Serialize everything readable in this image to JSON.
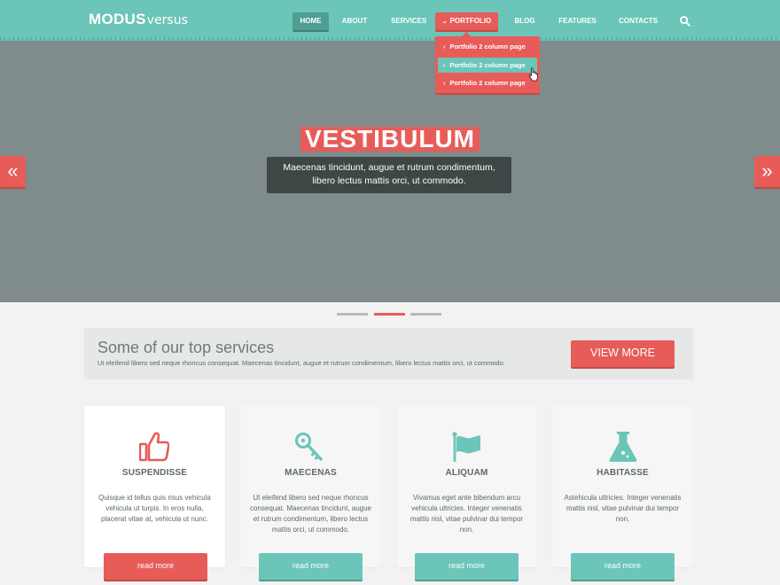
{
  "header": {
    "logo_main": "MODUS",
    "logo_sub": "versus",
    "nav": [
      {
        "label": "HOME"
      },
      {
        "label": "ABOUT"
      },
      {
        "label": "SERVICES"
      },
      {
        "label": "PORTFOLIO"
      },
      {
        "label": "BLOG"
      },
      {
        "label": "FEATURES"
      },
      {
        "label": "CONTACTS"
      }
    ],
    "search_icon": "search-icon",
    "active_nav": "HOME",
    "open_menu": "PORTFOLIO"
  },
  "dropdown": {
    "items": [
      {
        "label": "Portfolio 2 column page"
      },
      {
        "label": "Portfolio 2 column page"
      },
      {
        "label": "Portfolio 2 column page"
      }
    ],
    "hovered_index": 1
  },
  "hero": {
    "title": "VESTIBULUM",
    "caption_line1": "Maecenas tincidunt, augue et rutrum condimentum,",
    "caption_line2": "libero lectus mattis orci, ut commodo.",
    "prev_icon": "double-chevron-left-icon",
    "next_icon": "double-chevron-right-icon",
    "slide_count": 3,
    "active_slide": 2
  },
  "services": {
    "title": "Some of our top services",
    "subtitle": "Ut eleifend libero sed neque rhoncus consequat. Maecenas tincidunt, augue et rutrum condimentum, libero lectus mattis orci, ut commodo.",
    "button_label": "VIEW MORE"
  },
  "cards": [
    {
      "icon": "thumbs-up-icon",
      "title": "SUSPENDISSE",
      "text": "Quisque id tellus quis risus vehicula vehicula ut turpis. In eros nulla, placerat vitae at, vehicula ut nunc.",
      "button": "read more"
    },
    {
      "icon": "key-icon",
      "title": "MAECENAS",
      "text": "Ut eleifend libero sed neque rhoncus consequat. Maecenas tincidunt, augue et rutrum condimentum, libero lectus mattis orci, ut commodo.",
      "button": "read more"
    },
    {
      "icon": "flag-icon",
      "title": "ALIQUAM",
      "text": "Vivamus eget ante bibendum arcu vehicula ultricies. Integer venenatis mattis nisl, vitae pulvinar dui tempor non.",
      "button": "read more"
    },
    {
      "icon": "flask-icon",
      "title": "HABITASSE",
      "text": "Astehicula ultricies. Integer venenatis mattis nisl, vitae pulvinar dui tempor non.",
      "button": "read more"
    }
  ],
  "colors": {
    "teal": "#6bc5b8",
    "coral": "#e75c59",
    "hero_bg": "#7f8c8b",
    "text_dark": "#5d6868"
  }
}
